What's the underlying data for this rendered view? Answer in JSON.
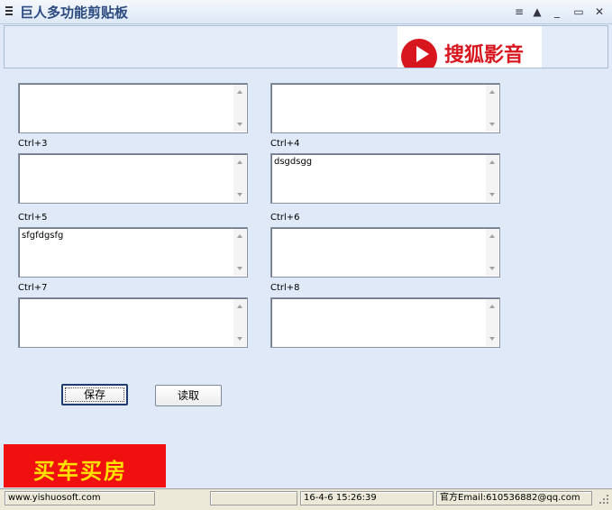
{
  "window": {
    "title": "巨人多功能剪贴板"
  },
  "banner": {
    "ad_text": "搜狐影音"
  },
  "slots": [
    {
      "label": "",
      "value": ""
    },
    {
      "label": "",
      "value": ""
    },
    {
      "label": "Ctrl+3",
      "value": ""
    },
    {
      "label": "Ctrl+4",
      "value": "dsgdsgg"
    },
    {
      "label": "Ctrl+5",
      "value": "sfgfdgsfg"
    },
    {
      "label": "Ctrl+6",
      "value": ""
    },
    {
      "label": "Ctrl+7",
      "value": ""
    },
    {
      "label": "Ctrl+8",
      "value": ""
    }
  ],
  "buttons": {
    "save": "保存",
    "load": "读取"
  },
  "ad2": {
    "text": "买车买房"
  },
  "statusbar": {
    "website": "www.yishuosoft.com",
    "empty": "",
    "datetime": "16-4-6 15:26:39",
    "email": "官方Email:610536882@qq.com"
  }
}
